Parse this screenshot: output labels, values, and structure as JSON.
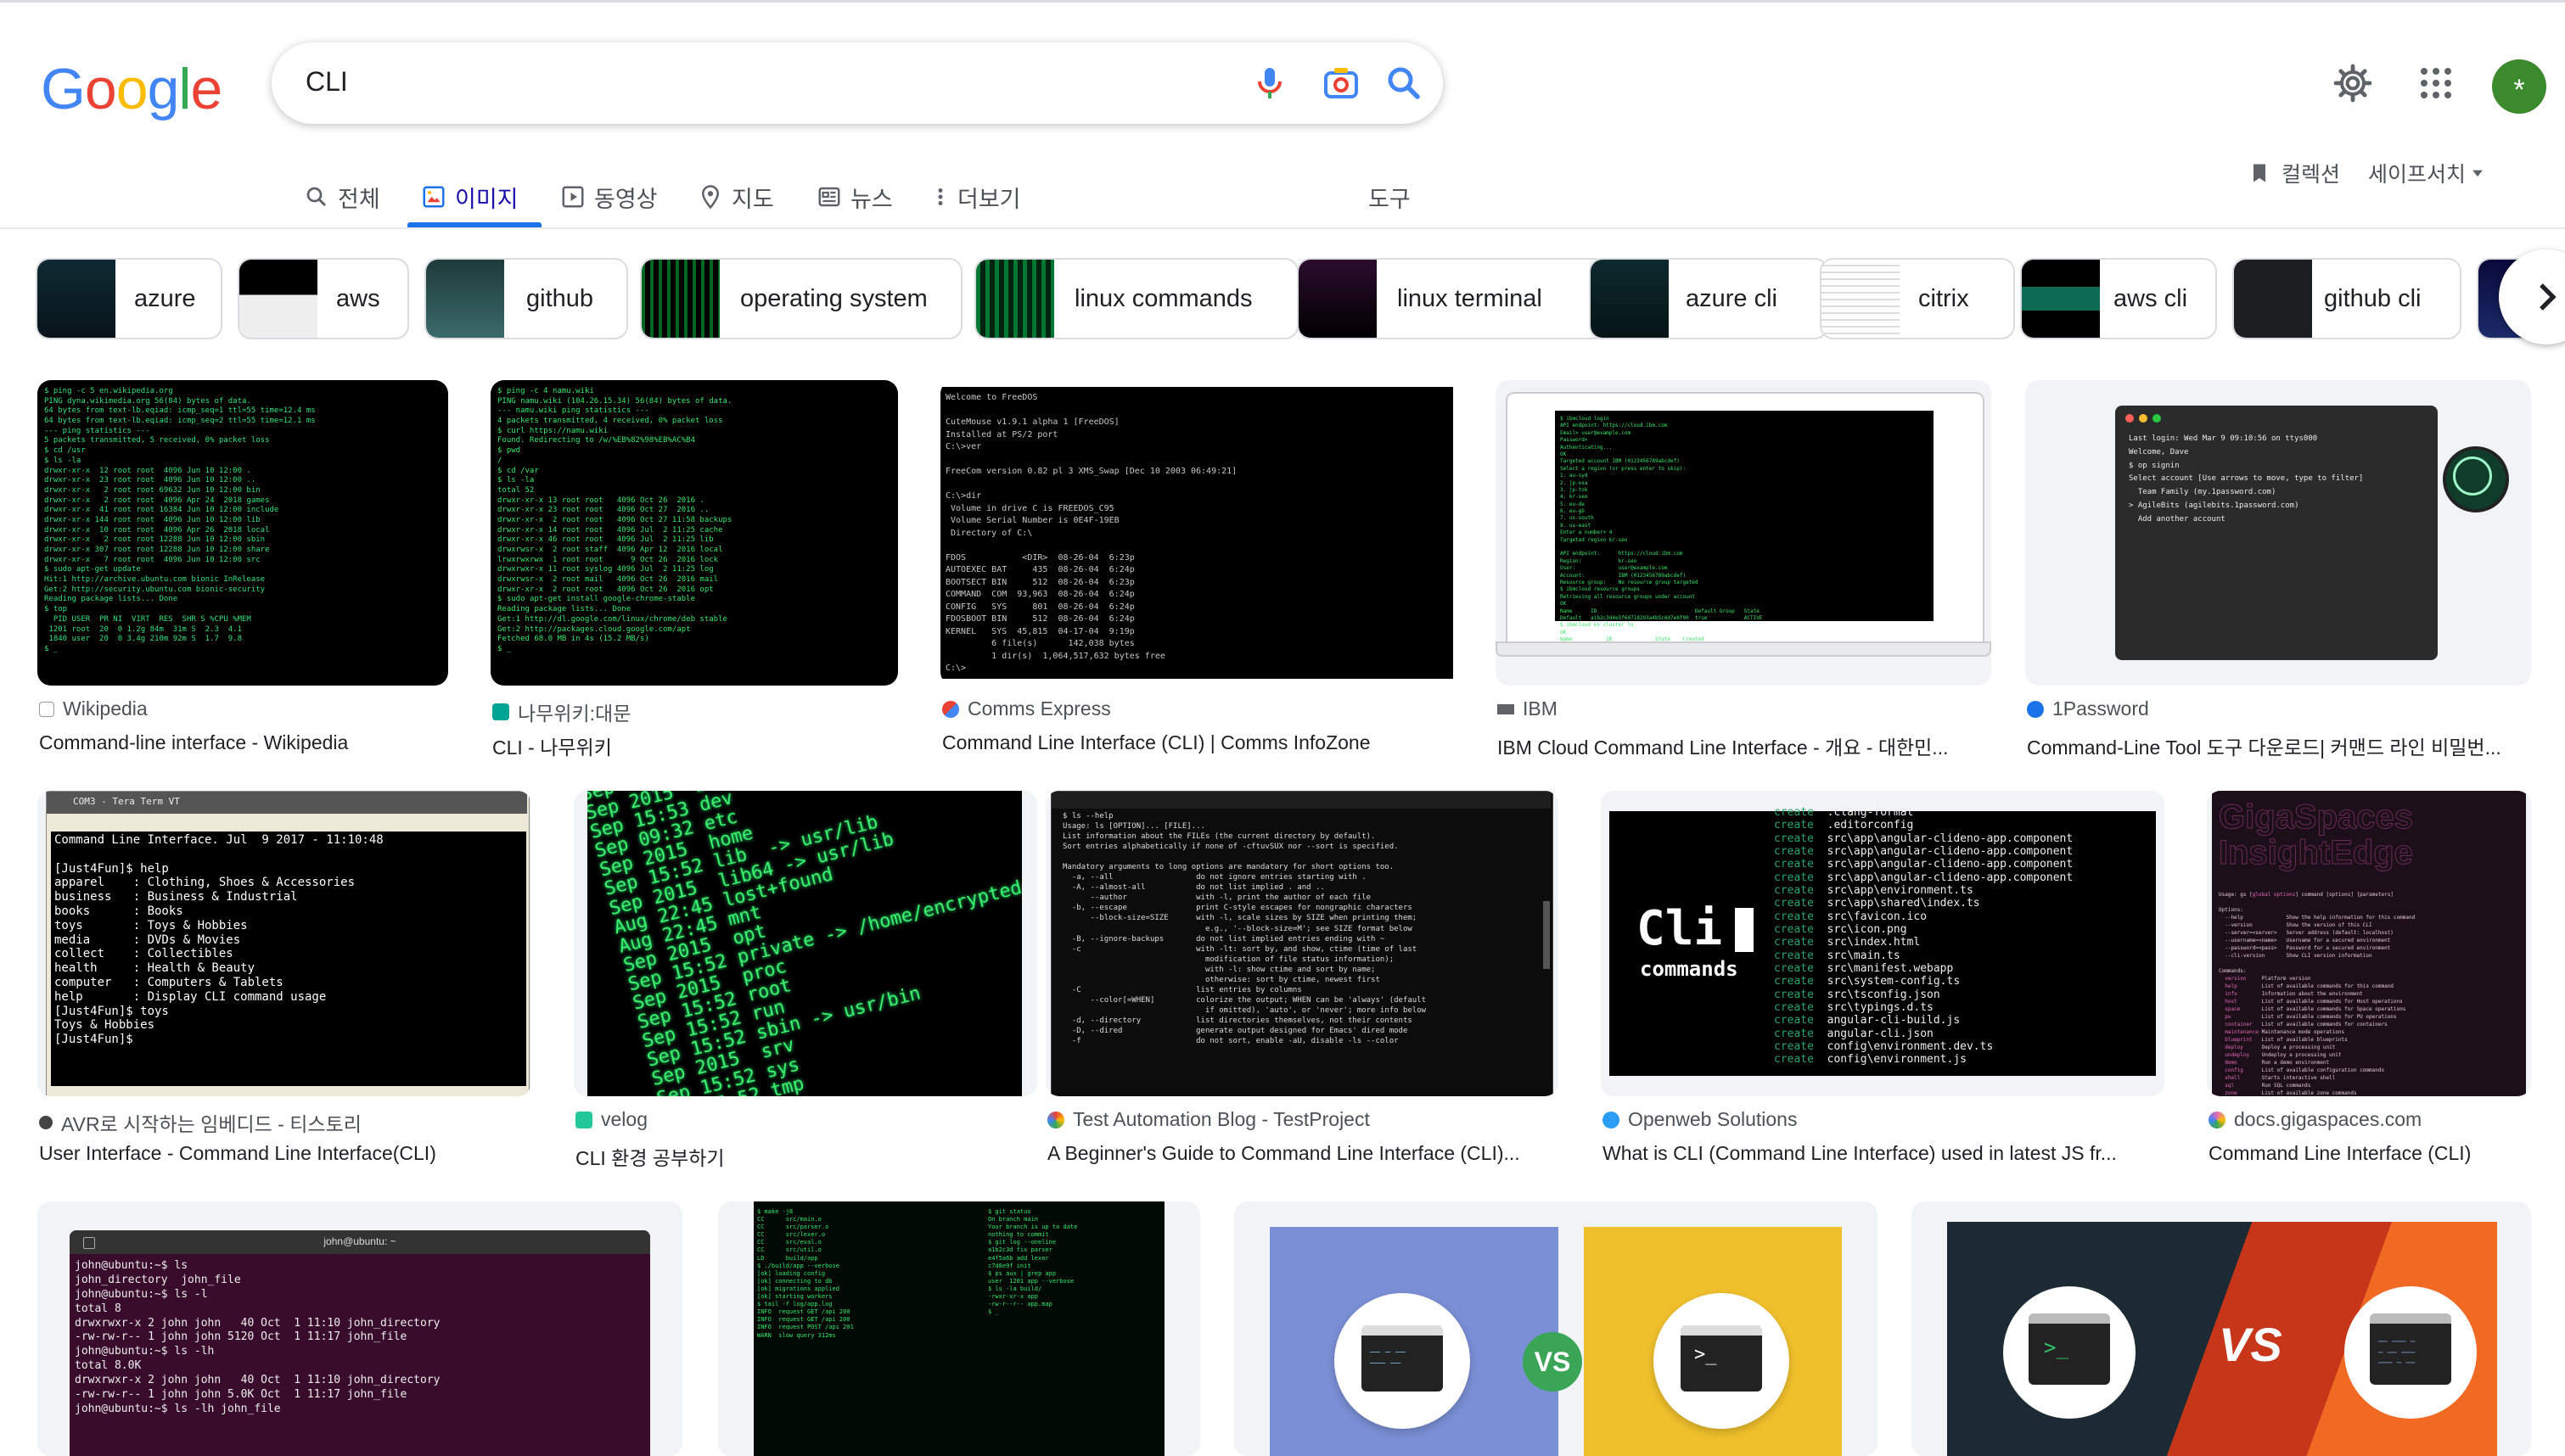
{
  "header": {
    "logo_letters": [
      "G",
      "o",
      "o",
      "g",
      "l",
      "e"
    ],
    "logo_colors": [
      "#4285f4",
      "#ea4335",
      "#fbbc05",
      "#4285f4",
      "#34a853",
      "#ea4335"
    ],
    "search_query": "CLI",
    "avatar_letter": "*",
    "icons": [
      "mic-icon",
      "camera-icon",
      "search-icon",
      "gear-icon",
      "apps-grid-icon"
    ]
  },
  "tabs": [
    {
      "label": "전체",
      "icon": "search-icon",
      "active": false
    },
    {
      "label": "이미지",
      "icon": "image-icon",
      "active": true
    },
    {
      "label": "동영상",
      "icon": "video-icon",
      "active": false
    },
    {
      "label": "지도",
      "icon": "map-pin-icon",
      "active": false
    },
    {
      "label": "뉴스",
      "icon": "news-icon",
      "active": false
    },
    {
      "label": "더보기",
      "icon": "more-vert-icon",
      "active": false
    }
  ],
  "tools_label": "도구",
  "collections_label": "컬렉션",
  "safesearch_label": "세이프서치",
  "chips": [
    "azure",
    "aws",
    "github",
    "operating system",
    "linux commands",
    "linux terminal",
    "azure cli",
    "citrix",
    "aws cli",
    "github cli"
  ],
  "results": [
    {
      "source": "Wikipedia",
      "title": "Command-line interface - Wikipedia"
    },
    {
      "source": "나무위키:대문",
      "title": "CLI - 나무위키"
    },
    {
      "source": "Comms Express",
      "title": "Command Line Interface (CLI) | Comms InfoZone"
    },
    {
      "source": "IBM",
      "title": "IBM Cloud Command Line Interface - 개요 - 대한민..."
    },
    {
      "source": "1Password",
      "title": "Command-Line Tool 도구 다운로드| 커맨드 라인 비밀번..."
    },
    {
      "source": "AVR로 시작하는 임베디드 - 티스토리",
      "title": "User Interface - Command Line Interface(CLI)"
    },
    {
      "source": "velog",
      "title": "CLI 환경 공부하기"
    },
    {
      "source": "Test Automation Blog - TestProject",
      "title": "A Beginner's Guide to Command Line Interface (CLI)..."
    },
    {
      "source": "Openweb Solutions",
      "title": "What is CLI (Command Line Interface) used in latest JS fr..."
    },
    {
      "source": "docs.gigaspaces.com",
      "title": "Command Line Interface (CLI)"
    }
  ],
  "image_text": {
    "freedos_title": "Welcome to FreeDOS",
    "pass_terminal": "Last login: Wed Mar 9 09:10:56 on ttys000\nWelcome, Dave\n$ op signin\nSelect account [Use arrows to move, type to filter]\n  Team Family (my.1password.com)\n> AgileBits (agilebits.1password.com)\n  Add another account",
    "avr_window": "COM3 - Tera Term VT",
    "avr_terminal": "Command Line Interface. Jul  9 2017 - 11:10:48\n\n[Just4Fun]$ help\napparel    : Clothing, Shoes & Accessories\nbusiness   : Business & Industrial\nbooks      : Books\ntoys       : Toys & Hobbies\nmedia      : DVDs & Movies\ncollect    : Collectibles\nhealth     : Health & Beauty\ncomputer   : Computers & Tablets\nhelp       : Display CLI command usage\n[Just4Fun]$ toys\nToys & Hobbies\n[Just4Fun]$",
    "openweb_big": "Cli",
    "openweb_small": "commands",
    "ubuntu_title": "john@ubuntu: ~",
    "ubuntu_terminal": "john@ubuntu:~$ ls\njohn_directory  john_file\njohn@ubuntu:~$ ls -l\ntotal 8\ndrwxrwxr-x 2 john john   40 Oct  1 11:10 john_directory\n-rw-rw-r-- 1 john john 5120 Oct  1 11:17 john_file\njohn@ubuntu:~$ ls -lh\ntotal 8.0K\ndrwxrwxr-x 2 john john   40 Oct  1 11:10 john_directory\n-rw-rw-r-- 1 john john 5.0K Oct  1 11:17 john_file\njohn@ubuntu:~$ ls -lh john_file",
    "vs": "VS",
    "prompt": ">_"
  }
}
